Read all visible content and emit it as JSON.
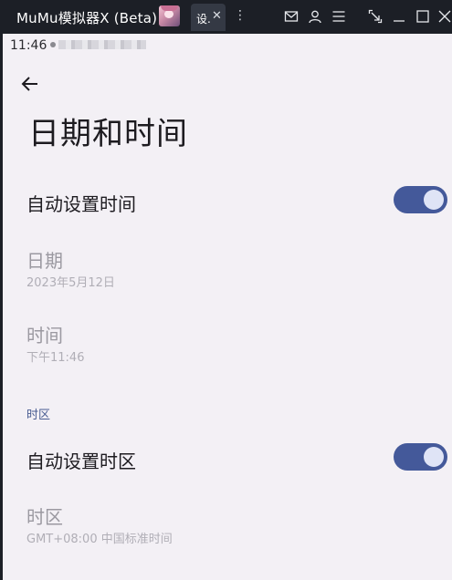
{
  "titlebar": {
    "app_title": "MuMu模拟器X  (Beta)",
    "tab_label": "设.",
    "tab_close": "✕",
    "tab_more": "⋮"
  },
  "status_bar": {
    "time": "11:46"
  },
  "page": {
    "title": "日期和时间"
  },
  "settings": {
    "auto_time": {
      "label": "自动设置时间",
      "enabled": true
    },
    "date": {
      "label": "日期",
      "value": "2023年5月12日"
    },
    "time": {
      "label": "时间",
      "value": "下午11:46"
    },
    "timezone_section": "时区",
    "auto_timezone": {
      "label": "自动设置时区",
      "enabled": true
    },
    "timezone": {
      "label": "时区",
      "value": "GMT+08:00 中国标准时间"
    }
  },
  "colors": {
    "accent": "#44599a",
    "section_header": "#4a5d92",
    "background": "#f3f0f5",
    "titlebar": "#1c1f26"
  },
  "icons": {
    "titlebar": [
      "mail-icon",
      "user-icon",
      "menu-icon",
      "screenshot-icon",
      "minimize-icon",
      "maximize-icon",
      "close-icon"
    ],
    "back": "arrow-left-icon"
  }
}
